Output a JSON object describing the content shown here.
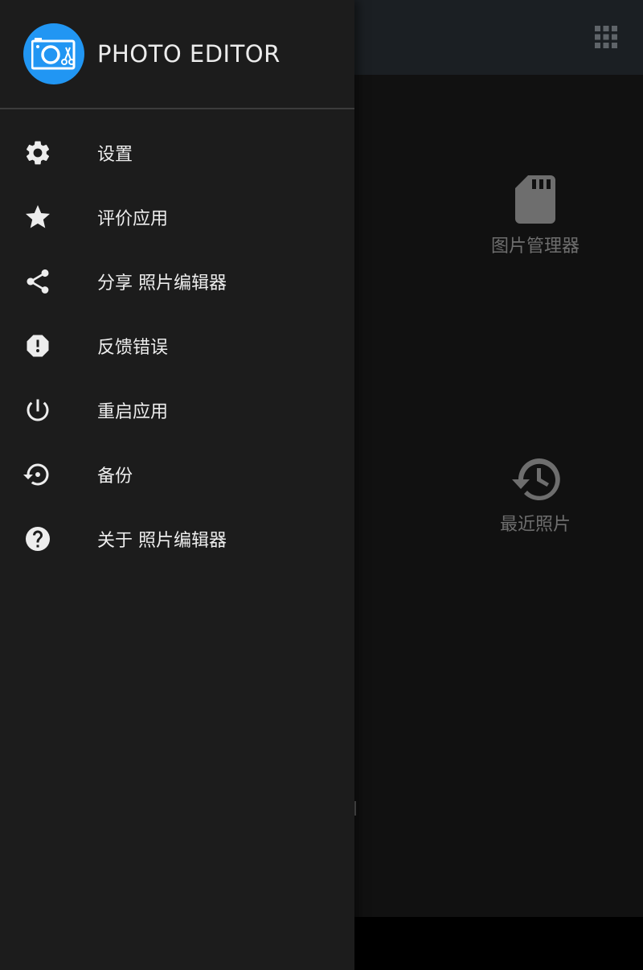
{
  "background_app": {
    "tiles": [
      {
        "label": "图片管理器",
        "icon": "sd-card-icon"
      },
      {
        "label": "最近照片",
        "icon": "history-icon"
      }
    ],
    "toolbar_icon": "grid-icon"
  },
  "drawer": {
    "app_name": "PHOTO EDITOR",
    "logo_icon": "camera-scissors-icon",
    "items": [
      {
        "label": "设置",
        "icon": "gear-icon"
      },
      {
        "label": "评价应用",
        "icon": "star-icon"
      },
      {
        "label": "分享 照片编辑器",
        "icon": "share-icon"
      },
      {
        "label": "反馈错误",
        "icon": "report-icon"
      },
      {
        "label": "重启应用",
        "icon": "power-icon"
      },
      {
        "label": "备份",
        "icon": "backup-restore-icon"
      },
      {
        "label": "关于 照片编辑器",
        "icon": "help-icon"
      }
    ]
  },
  "colors": {
    "drawer_bg": "#1c1c1c",
    "logo_bg": "#2196f3",
    "text": "#ededed",
    "dim_text": "#6e6e6e"
  }
}
